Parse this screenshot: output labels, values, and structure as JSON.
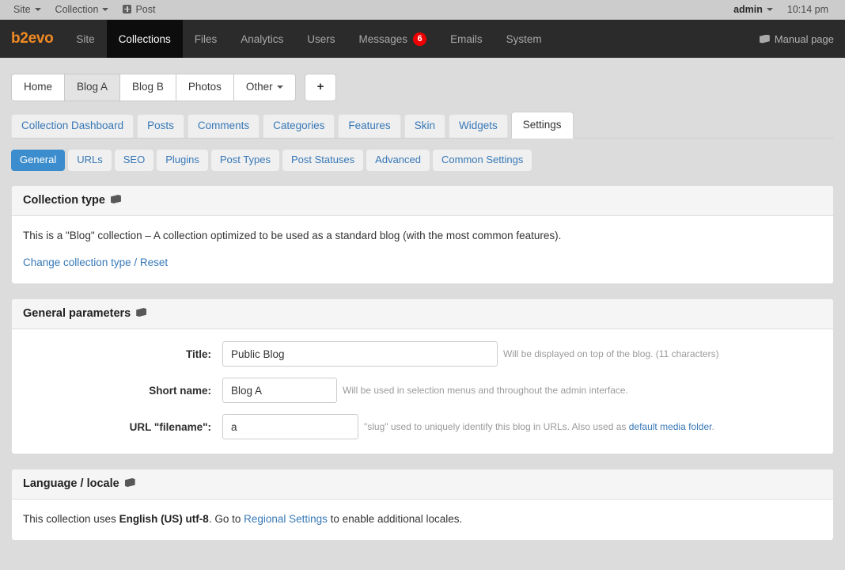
{
  "evobar": {
    "left_items": [
      {
        "label": "Site",
        "caret": true,
        "icon": null
      },
      {
        "label": "Collection",
        "caret": true,
        "icon": null
      },
      {
        "label": "Post",
        "caret": false,
        "icon": "plus-square-icon"
      }
    ],
    "user": "admin",
    "time": "10:14 pm"
  },
  "mainnav": {
    "brand": "b2evo",
    "brand_color": "#f08a23",
    "items": [
      {
        "label": "Site",
        "active": false,
        "badge": null
      },
      {
        "label": "Collections",
        "active": true,
        "badge": null
      },
      {
        "label": "Files",
        "active": false,
        "badge": null
      },
      {
        "label": "Analytics",
        "active": false,
        "badge": null
      },
      {
        "label": "Users",
        "active": false,
        "badge": null
      },
      {
        "label": "Messages",
        "active": false,
        "badge": "6"
      },
      {
        "label": "Emails",
        "active": false,
        "badge": null
      },
      {
        "label": "System",
        "active": false,
        "badge": null
      }
    ],
    "badge_color": "#ee0000",
    "manual_label": "Manual page",
    "manual_icon": "manual-book-icon"
  },
  "collection_tabs": {
    "items": [
      {
        "label": "Home",
        "active": false
      },
      {
        "label": "Blog A",
        "active": true
      },
      {
        "label": "Blog B",
        "active": false
      },
      {
        "label": "Photos",
        "active": false
      },
      {
        "label": "Other",
        "active": false,
        "caret": true
      }
    ],
    "add_label": "+"
  },
  "sub_tabs": [
    {
      "label": "Collection Dashboard",
      "active": false
    },
    {
      "label": "Posts",
      "active": false
    },
    {
      "label": "Comments",
      "active": false
    },
    {
      "label": "Categories",
      "active": false
    },
    {
      "label": "Features",
      "active": false
    },
    {
      "label": "Skin",
      "active": false
    },
    {
      "label": "Widgets",
      "active": false
    },
    {
      "label": "Settings",
      "active": true
    }
  ],
  "pill_tabs": [
    {
      "label": "General",
      "active": true
    },
    {
      "label": "URLs",
      "active": false
    },
    {
      "label": "SEO",
      "active": false
    },
    {
      "label": "Plugins",
      "active": false
    },
    {
      "label": "Post Types",
      "active": false
    },
    {
      "label": "Post Statuses",
      "active": false
    },
    {
      "label": "Advanced",
      "active": false
    },
    {
      "label": "Common Settings",
      "active": false
    }
  ],
  "collection_type_panel": {
    "title": "Collection type",
    "description": "This is a \"Blog\" collection – A collection optimized to be used as a standard blog (with the most common features).",
    "change_link": "Change collection type / Reset"
  },
  "general_parameters_panel": {
    "title": "General parameters",
    "fields": [
      {
        "label": "Title:",
        "value": "Public Blog",
        "placeholder": "",
        "help_prefix": "Will be displayed on top of the blog. (11 characters)",
        "help_link": "",
        "help_suffix": ""
      },
      {
        "label": "Short name:",
        "value": "Blog A",
        "placeholder": "",
        "help_prefix": "Will be used in selection menus and throughout the admin interface.",
        "help_link": "",
        "help_suffix": ""
      },
      {
        "label": "URL \"filename\":",
        "value": "a",
        "placeholder": "",
        "help_prefix": "\"slug\" used to uniquely identify this blog in URLs. Also used as ",
        "help_link": "default media folder",
        "help_suffix": "."
      }
    ]
  },
  "language_panel": {
    "title": "Language / locale",
    "text_before": "This collection uses ",
    "locale": "English (US) utf-8",
    "text_middle": ". Go to ",
    "link": "Regional Settings",
    "text_after": " to enable additional locales."
  }
}
